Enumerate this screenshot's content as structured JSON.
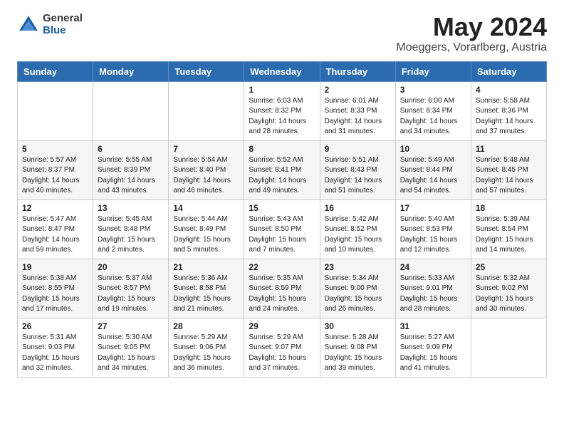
{
  "header": {
    "logo_general": "General",
    "logo_blue": "Blue",
    "title": "May 2024",
    "subtitle": "Moeggers, Vorarlberg, Austria"
  },
  "days_of_week": [
    "Sunday",
    "Monday",
    "Tuesday",
    "Wednesday",
    "Thursday",
    "Friday",
    "Saturday"
  ],
  "weeks": [
    {
      "row_class": "row-odd",
      "days": [
        {
          "num": "",
          "info": ""
        },
        {
          "num": "",
          "info": ""
        },
        {
          "num": "",
          "info": ""
        },
        {
          "num": "1",
          "info": "Sunrise: 6:03 AM\nSunset: 8:32 PM\nDaylight: 14 hours\nand 28 minutes."
        },
        {
          "num": "2",
          "info": "Sunrise: 6:01 AM\nSunset: 8:33 PM\nDaylight: 14 hours\nand 31 minutes."
        },
        {
          "num": "3",
          "info": "Sunrise: 6:00 AM\nSunset: 8:34 PM\nDaylight: 14 hours\nand 34 minutes."
        },
        {
          "num": "4",
          "info": "Sunrise: 5:58 AM\nSunset: 8:36 PM\nDaylight: 14 hours\nand 37 minutes."
        }
      ]
    },
    {
      "row_class": "row-even",
      "days": [
        {
          "num": "5",
          "info": "Sunrise: 5:57 AM\nSunset: 8:37 PM\nDaylight: 14 hours\nand 40 minutes."
        },
        {
          "num": "6",
          "info": "Sunrise: 5:55 AM\nSunset: 8:39 PM\nDaylight: 14 hours\nand 43 minutes."
        },
        {
          "num": "7",
          "info": "Sunrise: 5:54 AM\nSunset: 8:40 PM\nDaylight: 14 hours\nand 46 minutes."
        },
        {
          "num": "8",
          "info": "Sunrise: 5:52 AM\nSunset: 8:41 PM\nDaylight: 14 hours\nand 49 minutes."
        },
        {
          "num": "9",
          "info": "Sunrise: 5:51 AM\nSunset: 8:43 PM\nDaylight: 14 hours\nand 51 minutes."
        },
        {
          "num": "10",
          "info": "Sunrise: 5:49 AM\nSunset: 8:44 PM\nDaylight: 14 hours\nand 54 minutes."
        },
        {
          "num": "11",
          "info": "Sunrise: 5:48 AM\nSunset: 8:45 PM\nDaylight: 14 hours\nand 57 minutes."
        }
      ]
    },
    {
      "row_class": "row-odd",
      "days": [
        {
          "num": "12",
          "info": "Sunrise: 5:47 AM\nSunset: 8:47 PM\nDaylight: 14 hours\nand 59 minutes."
        },
        {
          "num": "13",
          "info": "Sunrise: 5:45 AM\nSunset: 8:48 PM\nDaylight: 15 hours\nand 2 minutes."
        },
        {
          "num": "14",
          "info": "Sunrise: 5:44 AM\nSunset: 8:49 PM\nDaylight: 15 hours\nand 5 minutes."
        },
        {
          "num": "15",
          "info": "Sunrise: 5:43 AM\nSunset: 8:50 PM\nDaylight: 15 hours\nand 7 minutes."
        },
        {
          "num": "16",
          "info": "Sunrise: 5:42 AM\nSunset: 8:52 PM\nDaylight: 15 hours\nand 10 minutes."
        },
        {
          "num": "17",
          "info": "Sunrise: 5:40 AM\nSunset: 8:53 PM\nDaylight: 15 hours\nand 12 minutes."
        },
        {
          "num": "18",
          "info": "Sunrise: 5:39 AM\nSunset: 8:54 PM\nDaylight: 15 hours\nand 14 minutes."
        }
      ]
    },
    {
      "row_class": "row-even",
      "days": [
        {
          "num": "19",
          "info": "Sunrise: 5:38 AM\nSunset: 8:55 PM\nDaylight: 15 hours\nand 17 minutes."
        },
        {
          "num": "20",
          "info": "Sunrise: 5:37 AM\nSunset: 8:57 PM\nDaylight: 15 hours\nand 19 minutes."
        },
        {
          "num": "21",
          "info": "Sunrise: 5:36 AM\nSunset: 8:58 PM\nDaylight: 15 hours\nand 21 minutes."
        },
        {
          "num": "22",
          "info": "Sunrise: 5:35 AM\nSunset: 8:59 PM\nDaylight: 15 hours\nand 24 minutes."
        },
        {
          "num": "23",
          "info": "Sunrise: 5:34 AM\nSunset: 9:00 PM\nDaylight: 15 hours\nand 26 minutes."
        },
        {
          "num": "24",
          "info": "Sunrise: 5:33 AM\nSunset: 9:01 PM\nDaylight: 15 hours\nand 28 minutes."
        },
        {
          "num": "25",
          "info": "Sunrise: 5:32 AM\nSunset: 9:02 PM\nDaylight: 15 hours\nand 30 minutes."
        }
      ]
    },
    {
      "row_class": "row-odd",
      "days": [
        {
          "num": "26",
          "info": "Sunrise: 5:31 AM\nSunset: 9:03 PM\nDaylight: 15 hours\nand 32 minutes."
        },
        {
          "num": "27",
          "info": "Sunrise: 5:30 AM\nSunset: 9:05 PM\nDaylight: 15 hours\nand 34 minutes."
        },
        {
          "num": "28",
          "info": "Sunrise: 5:29 AM\nSunset: 9:06 PM\nDaylight: 15 hours\nand 36 minutes."
        },
        {
          "num": "29",
          "info": "Sunrise: 5:29 AM\nSunset: 9:07 PM\nDaylight: 15 hours\nand 37 minutes."
        },
        {
          "num": "30",
          "info": "Sunrise: 5:28 AM\nSunset: 9:08 PM\nDaylight: 15 hours\nand 39 minutes."
        },
        {
          "num": "31",
          "info": "Sunrise: 5:27 AM\nSunset: 9:09 PM\nDaylight: 15 hours\nand 41 minutes."
        },
        {
          "num": "",
          "info": ""
        }
      ]
    }
  ]
}
